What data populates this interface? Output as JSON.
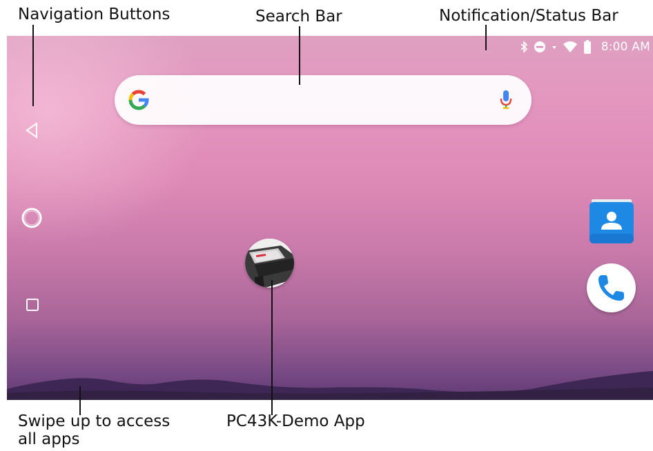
{
  "callouts": {
    "nav_buttons": "Navigation Buttons",
    "search_bar": "Search Bar",
    "status_bar": "Notification/Status Bar",
    "swipe_up_line1": "Swipe up to access",
    "swipe_up_line2": "all apps",
    "demo_app": "PC43K-Demo App"
  },
  "status_bar": {
    "time": "8:00 AM",
    "icons": [
      "bluetooth-icon",
      "do-not-disturb-icon",
      "wifi-icon",
      "battery-icon"
    ]
  },
  "search_bar": {
    "icons": [
      "google-g-icon",
      "microphone-icon"
    ]
  },
  "navigation": {
    "icons": [
      "back-triangle-icon",
      "home-circle-icon",
      "recents-square-icon"
    ]
  },
  "home_screen": {
    "apps": [
      "pc43k-demo-app-icon",
      "contacts-icon",
      "phone-icon"
    ],
    "swipe_icon": "chevron-up-icon"
  },
  "colors": {
    "wallpaper_top": "#e496bf",
    "wallpaper_bottom": "#5e3a73",
    "hills": "#3e2754",
    "contacts_blue": "#1e88e5",
    "phone_blue": "#1e88e5"
  }
}
